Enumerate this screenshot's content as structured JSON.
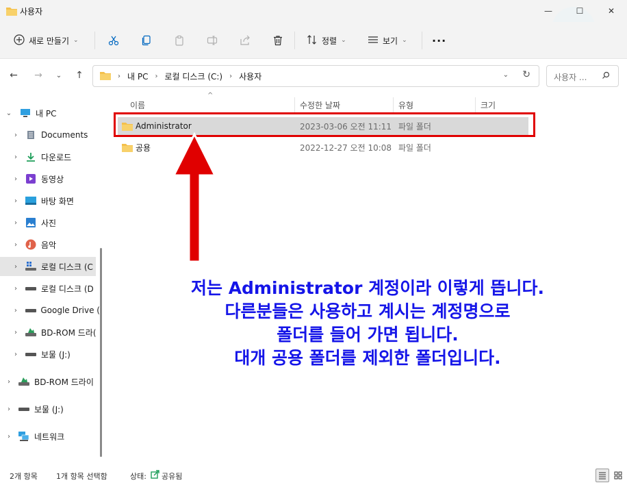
{
  "window": {
    "title": "사용자",
    "minimize": "—",
    "maximize": "☐",
    "close": "✕"
  },
  "toolbar": {
    "new_label": "새로 만들기",
    "sort_label": "정렬",
    "view_label": "보기",
    "more": "···"
  },
  "address": {
    "segments": [
      "내 PC",
      "로컬 디스크 (C:)",
      "사용자"
    ],
    "search_placeholder": "사용자 ..."
  },
  "nav": {
    "items": [
      {
        "label": "내 PC"
      },
      {
        "label": "Documents"
      },
      {
        "label": "다운로드"
      },
      {
        "label": "동영상"
      },
      {
        "label": "바탕 화면"
      },
      {
        "label": "사진"
      },
      {
        "label": "음악"
      },
      {
        "label": "로컬 디스크 (C"
      },
      {
        "label": "로컬 디스크 (D"
      },
      {
        "label": "Google Drive ("
      },
      {
        "label": "BD-ROM 드라("
      },
      {
        "label": "보물 (J:)"
      },
      {
        "label": "BD-ROM 드라이"
      },
      {
        "label": "보물 (J:)"
      },
      {
        "label": "네트워크"
      }
    ]
  },
  "columns": {
    "name": "이름",
    "modified": "수정한 날짜",
    "type": "유형",
    "size": "크기"
  },
  "files": [
    {
      "name": "Administrator",
      "modified": "2023-03-06 오전 11:11",
      "type": "파일 폴더"
    },
    {
      "name": "공용",
      "modified": "2022-12-27 오전 10:08",
      "type": "파일 폴더"
    }
  ],
  "annotation": {
    "lines": [
      "저는 Administrator 계정이라 이렇게 뜹니다.",
      "다른분들은 사용하고 계시는 계정명으로",
      "폴더를 들어 가면 됩니다.",
      "대개 공용 폴더를 제외한 폴더입니다."
    ]
  },
  "status": {
    "count": "2개 항목",
    "selected": "1개 항목 선택함",
    "state_label": "상태:",
    "state_value": "공유됨"
  },
  "colors": {
    "accent": "#0067c0",
    "annotation": "#1515e8",
    "highlight": "#e00000",
    "folder": "#f4c04c"
  }
}
